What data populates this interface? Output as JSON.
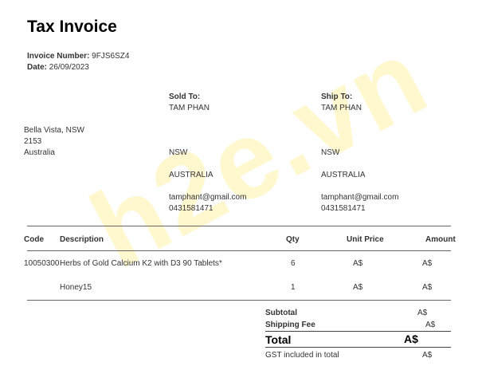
{
  "title": "Tax Invoice",
  "invoice": {
    "number_label": "Invoice Number:",
    "number_value": "9FJS6SZ4",
    "date_label": "Date:",
    "date_value": "26/09/2023"
  },
  "seller_address": {
    "line1": "Bella Vista, NSW",
    "line2": "2153",
    "line3": "Australia"
  },
  "sold_to": {
    "label": "Sold To:",
    "name": "TAM PHAN",
    "state": "NSW",
    "country": "AUSTRALIA",
    "email": "tamphant@gmail.com",
    "phone": "0431581471"
  },
  "ship_to": {
    "label": "Ship To:",
    "name": "TAM PHAN",
    "state": "NSW",
    "country": "AUSTRALIA",
    "email": "tamphant@gmail.com",
    "phone": "0431581471"
  },
  "table": {
    "headers": {
      "code": "Code",
      "description": "Description",
      "qty": "Qty",
      "unit_price": "Unit Price",
      "amount": "Amount"
    },
    "rows": [
      {
        "code": "10050300",
        "description": "Herbs of Gold Calcium K2 with D3 90 Tablets*",
        "qty": "6",
        "unit_price": "A$",
        "amount": "A$"
      },
      {
        "code": "",
        "description": "Honey15",
        "qty": "1",
        "unit_price": "A$",
        "amount": "A$"
      }
    ]
  },
  "summary": {
    "subtotal_label": "Subtotal",
    "subtotal_value": "A$",
    "shipping_label": "Shipping Fee",
    "shipping_value": "A$",
    "total_label": "Total",
    "total_value": "A$",
    "gst_label": "GST included in total",
    "gst_value": "A$"
  },
  "watermark": "h2e.vn"
}
